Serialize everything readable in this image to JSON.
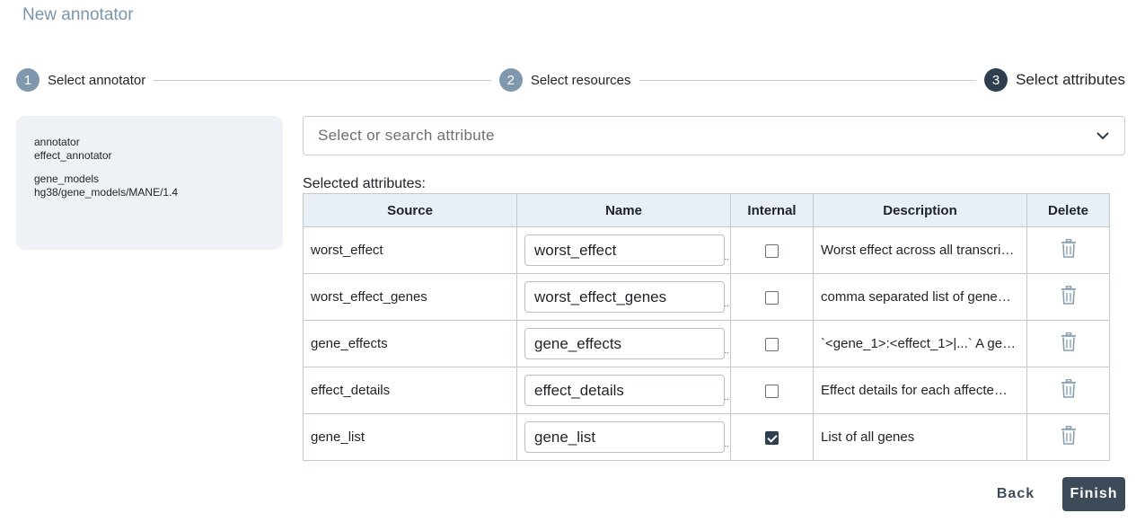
{
  "page": {
    "title": "New annotator"
  },
  "stepper": {
    "steps": [
      {
        "number": "1",
        "label": "Select annotator"
      },
      {
        "number": "2",
        "label": "Select resources"
      },
      {
        "number": "3",
        "label": "Select attributes"
      }
    ]
  },
  "summary": {
    "annotator_key": "annotator",
    "annotator_value": "effect_annotator",
    "gene_models_key": "gene_models",
    "gene_models_value": "hg38/gene_models/MANE/1.4"
  },
  "search": {
    "placeholder": "Select or search attribute",
    "icon": "chevron-down-icon"
  },
  "selected": {
    "label": "Selected attributes:",
    "columns": {
      "source": "Source",
      "name": "Name",
      "internal": "Internal",
      "description": "Description",
      "delete": "Delete"
    },
    "rows": [
      {
        "source": "worst_effect",
        "name": "worst_effect",
        "internal": false,
        "description": "Worst effect across all transcri…"
      },
      {
        "source": "worst_effect_genes",
        "name": "worst_effect_genes",
        "internal": false,
        "description": "comma separated list of gene…"
      },
      {
        "source": "gene_effects",
        "name": "gene_effects",
        "internal": false,
        "description": "`<gene_1>:<effect_1>|...` A gen…"
      },
      {
        "source": "effect_details",
        "name": "effect_details",
        "internal": false,
        "description": "Effect details for each affecte…"
      },
      {
        "source": "gene_list",
        "name": "gene_list",
        "internal": true,
        "description": "List of all genes"
      }
    ]
  },
  "actions": {
    "back": "Back",
    "finish": "Finish"
  },
  "colors": {
    "accent_dark": "#2f3f4f",
    "step_done": "#7f98ad",
    "title": "#7b95ab",
    "header_bg": "#e9eff6",
    "delete_icon": "#8aa0b2"
  }
}
